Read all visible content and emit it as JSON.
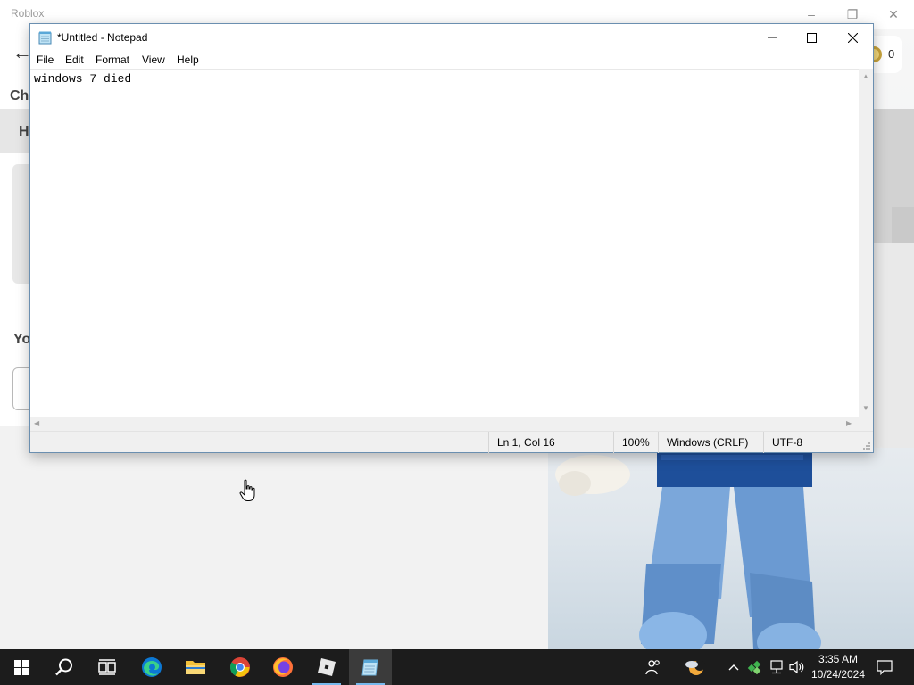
{
  "background_window": {
    "title": "Roblox",
    "partial_labels": [
      "Ch",
      "H",
      "Yo"
    ],
    "robux_count": "0"
  },
  "notepad": {
    "title": "*Untitled - Notepad",
    "menu": [
      "File",
      "Edit",
      "Format",
      "View",
      "Help"
    ],
    "content": "windows 7 died",
    "status": {
      "position": "Ln 1, Col 16",
      "zoom": "100%",
      "line_ending": "Windows (CRLF)",
      "encoding": "UTF-8"
    }
  },
  "taskbar": {
    "pinned": [
      "start-icon",
      "search-icon",
      "task-view-icon",
      "edge-icon",
      "file-explorer-icon",
      "chrome-icon",
      "firefox-icon",
      "roblox-icon",
      "notepad-icon"
    ],
    "active_app": "notepad",
    "clock": {
      "time": "3:35 AM",
      "date": "10/24/2024"
    }
  },
  "colors": {
    "taskbar": "#1c1c1c",
    "window_border": "#6b8fb0",
    "accent": "#76b9ed"
  }
}
